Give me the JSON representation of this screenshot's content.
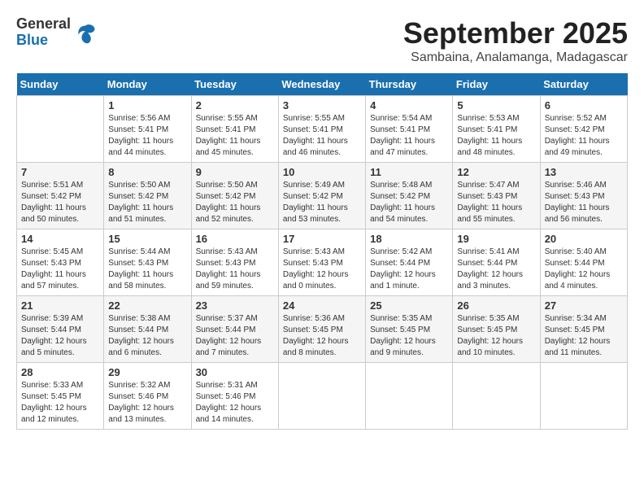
{
  "header": {
    "logo": {
      "general": "General",
      "blue": "Blue"
    },
    "title": "September 2025",
    "location": "Sambaina, Analamanga, Madagascar"
  },
  "weekdays": [
    "Sunday",
    "Monday",
    "Tuesday",
    "Wednesday",
    "Thursday",
    "Friday",
    "Saturday"
  ],
  "weeks": [
    [
      {
        "day": "",
        "sunrise": "",
        "sunset": "",
        "daylight": ""
      },
      {
        "day": "1",
        "sunrise": "Sunrise: 5:56 AM",
        "sunset": "Sunset: 5:41 PM",
        "daylight": "Daylight: 11 hours and 44 minutes."
      },
      {
        "day": "2",
        "sunrise": "Sunrise: 5:55 AM",
        "sunset": "Sunset: 5:41 PM",
        "daylight": "Daylight: 11 hours and 45 minutes."
      },
      {
        "day": "3",
        "sunrise": "Sunrise: 5:55 AM",
        "sunset": "Sunset: 5:41 PM",
        "daylight": "Daylight: 11 hours and 46 minutes."
      },
      {
        "day": "4",
        "sunrise": "Sunrise: 5:54 AM",
        "sunset": "Sunset: 5:41 PM",
        "daylight": "Daylight: 11 hours and 47 minutes."
      },
      {
        "day": "5",
        "sunrise": "Sunrise: 5:53 AM",
        "sunset": "Sunset: 5:41 PM",
        "daylight": "Daylight: 11 hours and 48 minutes."
      },
      {
        "day": "6",
        "sunrise": "Sunrise: 5:52 AM",
        "sunset": "Sunset: 5:42 PM",
        "daylight": "Daylight: 11 hours and 49 minutes."
      }
    ],
    [
      {
        "day": "7",
        "sunrise": "Sunrise: 5:51 AM",
        "sunset": "Sunset: 5:42 PM",
        "daylight": "Daylight: 11 hours and 50 minutes."
      },
      {
        "day": "8",
        "sunrise": "Sunrise: 5:50 AM",
        "sunset": "Sunset: 5:42 PM",
        "daylight": "Daylight: 11 hours and 51 minutes."
      },
      {
        "day": "9",
        "sunrise": "Sunrise: 5:50 AM",
        "sunset": "Sunset: 5:42 PM",
        "daylight": "Daylight: 11 hours and 52 minutes."
      },
      {
        "day": "10",
        "sunrise": "Sunrise: 5:49 AM",
        "sunset": "Sunset: 5:42 PM",
        "daylight": "Daylight: 11 hours and 53 minutes."
      },
      {
        "day": "11",
        "sunrise": "Sunrise: 5:48 AM",
        "sunset": "Sunset: 5:42 PM",
        "daylight": "Daylight: 11 hours and 54 minutes."
      },
      {
        "day": "12",
        "sunrise": "Sunrise: 5:47 AM",
        "sunset": "Sunset: 5:43 PM",
        "daylight": "Daylight: 11 hours and 55 minutes."
      },
      {
        "day": "13",
        "sunrise": "Sunrise: 5:46 AM",
        "sunset": "Sunset: 5:43 PM",
        "daylight": "Daylight: 11 hours and 56 minutes."
      }
    ],
    [
      {
        "day": "14",
        "sunrise": "Sunrise: 5:45 AM",
        "sunset": "Sunset: 5:43 PM",
        "daylight": "Daylight: 11 hours and 57 minutes."
      },
      {
        "day": "15",
        "sunrise": "Sunrise: 5:44 AM",
        "sunset": "Sunset: 5:43 PM",
        "daylight": "Daylight: 11 hours and 58 minutes."
      },
      {
        "day": "16",
        "sunrise": "Sunrise: 5:43 AM",
        "sunset": "Sunset: 5:43 PM",
        "daylight": "Daylight: 11 hours and 59 minutes."
      },
      {
        "day": "17",
        "sunrise": "Sunrise: 5:43 AM",
        "sunset": "Sunset: 5:43 PM",
        "daylight": "Daylight: 12 hours and 0 minutes."
      },
      {
        "day": "18",
        "sunrise": "Sunrise: 5:42 AM",
        "sunset": "Sunset: 5:44 PM",
        "daylight": "Daylight: 12 hours and 1 minute."
      },
      {
        "day": "19",
        "sunrise": "Sunrise: 5:41 AM",
        "sunset": "Sunset: 5:44 PM",
        "daylight": "Daylight: 12 hours and 3 minutes."
      },
      {
        "day": "20",
        "sunrise": "Sunrise: 5:40 AM",
        "sunset": "Sunset: 5:44 PM",
        "daylight": "Daylight: 12 hours and 4 minutes."
      }
    ],
    [
      {
        "day": "21",
        "sunrise": "Sunrise: 5:39 AM",
        "sunset": "Sunset: 5:44 PM",
        "daylight": "Daylight: 12 hours and 5 minutes."
      },
      {
        "day": "22",
        "sunrise": "Sunrise: 5:38 AM",
        "sunset": "Sunset: 5:44 PM",
        "daylight": "Daylight: 12 hours and 6 minutes."
      },
      {
        "day": "23",
        "sunrise": "Sunrise: 5:37 AM",
        "sunset": "Sunset: 5:44 PM",
        "daylight": "Daylight: 12 hours and 7 minutes."
      },
      {
        "day": "24",
        "sunrise": "Sunrise: 5:36 AM",
        "sunset": "Sunset: 5:45 PM",
        "daylight": "Daylight: 12 hours and 8 minutes."
      },
      {
        "day": "25",
        "sunrise": "Sunrise: 5:35 AM",
        "sunset": "Sunset: 5:45 PM",
        "daylight": "Daylight: 12 hours and 9 minutes."
      },
      {
        "day": "26",
        "sunrise": "Sunrise: 5:35 AM",
        "sunset": "Sunset: 5:45 PM",
        "daylight": "Daylight: 12 hours and 10 minutes."
      },
      {
        "day": "27",
        "sunrise": "Sunrise: 5:34 AM",
        "sunset": "Sunset: 5:45 PM",
        "daylight": "Daylight: 12 hours and 11 minutes."
      }
    ],
    [
      {
        "day": "28",
        "sunrise": "Sunrise: 5:33 AM",
        "sunset": "Sunset: 5:45 PM",
        "daylight": "Daylight: 12 hours and 12 minutes."
      },
      {
        "day": "29",
        "sunrise": "Sunrise: 5:32 AM",
        "sunset": "Sunset: 5:46 PM",
        "daylight": "Daylight: 12 hours and 13 minutes."
      },
      {
        "day": "30",
        "sunrise": "Sunrise: 5:31 AM",
        "sunset": "Sunset: 5:46 PM",
        "daylight": "Daylight: 12 hours and 14 minutes."
      },
      {
        "day": "",
        "sunrise": "",
        "sunset": "",
        "daylight": ""
      },
      {
        "day": "",
        "sunrise": "",
        "sunset": "",
        "daylight": ""
      },
      {
        "day": "",
        "sunrise": "",
        "sunset": "",
        "daylight": ""
      },
      {
        "day": "",
        "sunrise": "",
        "sunset": "",
        "daylight": ""
      }
    ]
  ]
}
